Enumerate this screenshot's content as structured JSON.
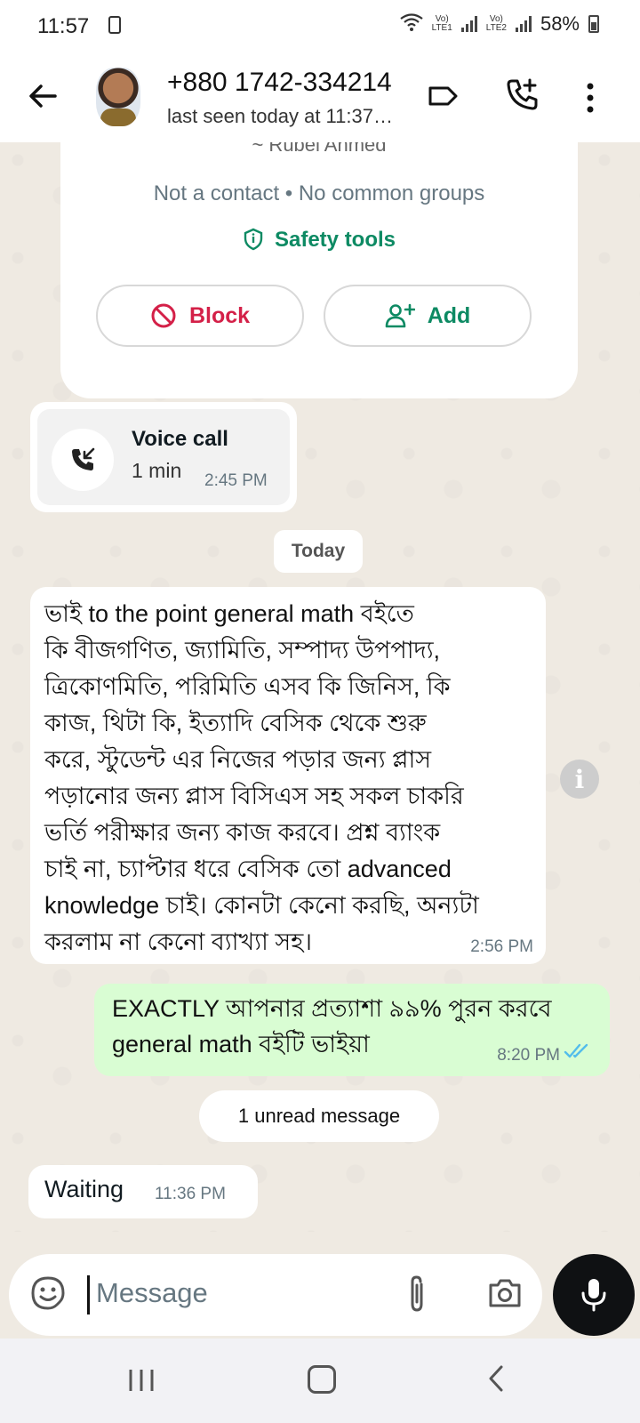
{
  "status_bar": {
    "time": "11:57",
    "battery": "58%",
    "lte1": "Vo) LTE1",
    "lte2": "Vo) LTE2"
  },
  "header": {
    "phone": "+880 1742-334214",
    "last_seen": "last seen today at 11:37…"
  },
  "info_card": {
    "cut_name": "~ Rubel Ahmed",
    "meta": "Not a contact • No common groups",
    "safety_label": "Safety tools",
    "block_label": "Block",
    "add_label": "Add"
  },
  "call": {
    "title": "Voice call",
    "duration": "1 min",
    "time": "2:45 PM"
  },
  "date_chip": "Today",
  "messages": [
    {
      "direction": "in",
      "lines": [
        "ভাই to the point general math বইতে",
        "কি বীজগণিত, জ্যামিতি, সম্পাদ্য উপপাদ্য,",
        "ত্রিকোণমিতি, পরিমিতি এসব কি জিনিস, কি",
        "কাজ, থিটা কি, ইত্যাদি বেসিক থেকে শুরু",
        "করে, স্টুডেন্ট এর নিজের পড়ার জন্য প্লাস",
        "পড়ানোর জন্য প্লাস বিসিএস সহ সকল চাকরি",
        "ভর্তি পরীক্ষার জন্য কাজ করবে। প্রশ্ন ব্যাংক",
        "চাই না, চ্যাপ্টার ধরে বেসিক তো advanced",
        "knowledge চাই। কোনটা কেনো করছি, অন্যটা",
        "করলাম না কেনো ব্যাখ্যা সহ।"
      ],
      "time": "2:56 PM"
    },
    {
      "direction": "out",
      "lines": [
        "EXACTLY আপনার প্রত্যাশা ৯৯% পুরন করবে",
        "general math বইটি ভাইয়া"
      ],
      "time": "8:20 PM",
      "read": true
    },
    {
      "direction": "in",
      "text": "Waiting",
      "time": "11:36 PM"
    }
  ],
  "unread_chip": "1 unread message",
  "composer": {
    "placeholder": "Message"
  },
  "colors": {
    "accent_green": "#0d8a63",
    "block_red": "#d42048",
    "outgoing_bubble": "#d9fdd3",
    "read_tick": "#53bdeb"
  }
}
